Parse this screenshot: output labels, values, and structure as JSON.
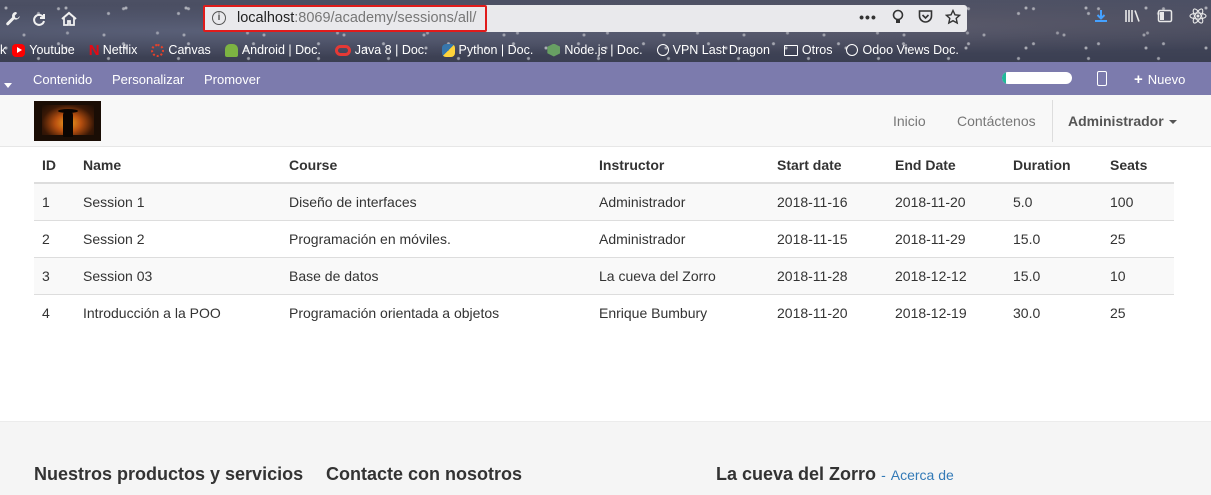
{
  "browser": {
    "url_host": "localhost",
    "url_rest": ":8069/academy/sessions/all/",
    "bookmarks": [
      {
        "label": "Youtube",
        "color": "#ff0000"
      },
      {
        "label": "Netflix",
        "color": "#e50914"
      },
      {
        "label": "Canvas",
        "color": "#e4412b"
      },
      {
        "label": "Android | Doc.",
        "color": "#7cb342"
      },
      {
        "label": "Java 8 | Doc.",
        "color": "#e53935"
      },
      {
        "label": "Python | Doc.",
        "color": "#3776ab"
      },
      {
        "label": "Node.js | Doc.",
        "color": "#68a063"
      },
      {
        "label": "VPN Last Dragon",
        "color": "#ffffff"
      },
      {
        "label": "Otros",
        "color": "#ffffff"
      },
      {
        "label": "Odoo Views Doc.",
        "color": "#ffffff"
      }
    ],
    "bookmarks_prefix": "k"
  },
  "editbar": {
    "contenido": "Contenido",
    "personalizar": "Personalizar",
    "promover": "Promover",
    "progress": 0.05,
    "nuevo": "Nuevo"
  },
  "header": {
    "inicio": "Inicio",
    "contactenos": "Contáctenos",
    "user": "Administrador"
  },
  "table": {
    "columns": [
      "ID",
      "Name",
      "Course",
      "Instructor",
      "Start date",
      "End Date",
      "Duration",
      "Seats"
    ],
    "rows": [
      [
        "1",
        "Session 1",
        "Diseño de interfaces",
        "Administrador",
        "2018-11-16",
        "2018-11-20",
        "5.0",
        "100"
      ],
      [
        "2",
        "Session 2",
        "Programación en móviles.",
        "Administrador",
        "2018-11-15",
        "2018-11-29",
        "15.0",
        "25"
      ],
      [
        "3",
        "Session 03",
        "Base de datos",
        "La cueva del Zorro",
        "2018-11-28",
        "2018-12-12",
        "15.0",
        "10"
      ],
      [
        "4",
        "Introducción a la POO",
        "Programación orientada a objetos",
        "Enrique Bumbury",
        "2018-11-20",
        "2018-12-19",
        "30.0",
        "25"
      ]
    ]
  },
  "footer": {
    "products": "Nuestros productos y servicios",
    "contact": "Contacte con nosotros",
    "company": "La cueva del Zorro",
    "about_sep": "-",
    "about": "Acerca de"
  }
}
